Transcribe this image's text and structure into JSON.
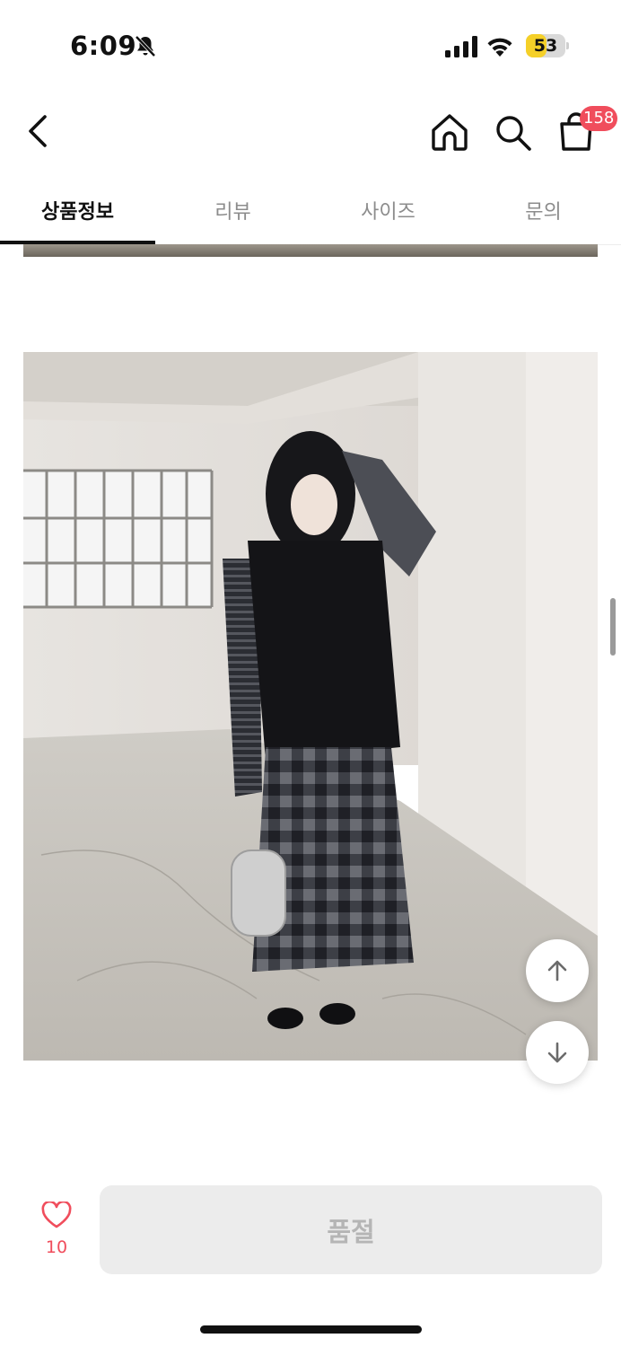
{
  "status_bar": {
    "time": "6:09",
    "battery": "53",
    "battery_level": 0.53
  },
  "header": {
    "cart_badge": "158"
  },
  "tabs": [
    {
      "label": "상품정보",
      "active": true
    },
    {
      "label": "리뷰",
      "active": false
    },
    {
      "label": "사이즈",
      "active": false
    },
    {
      "label": "문의",
      "active": false
    }
  ],
  "bottom_bar": {
    "like_count": "10",
    "soldout_label": "품절"
  },
  "colors": {
    "accent": "#f04d5c",
    "battery": "#f5d028"
  }
}
